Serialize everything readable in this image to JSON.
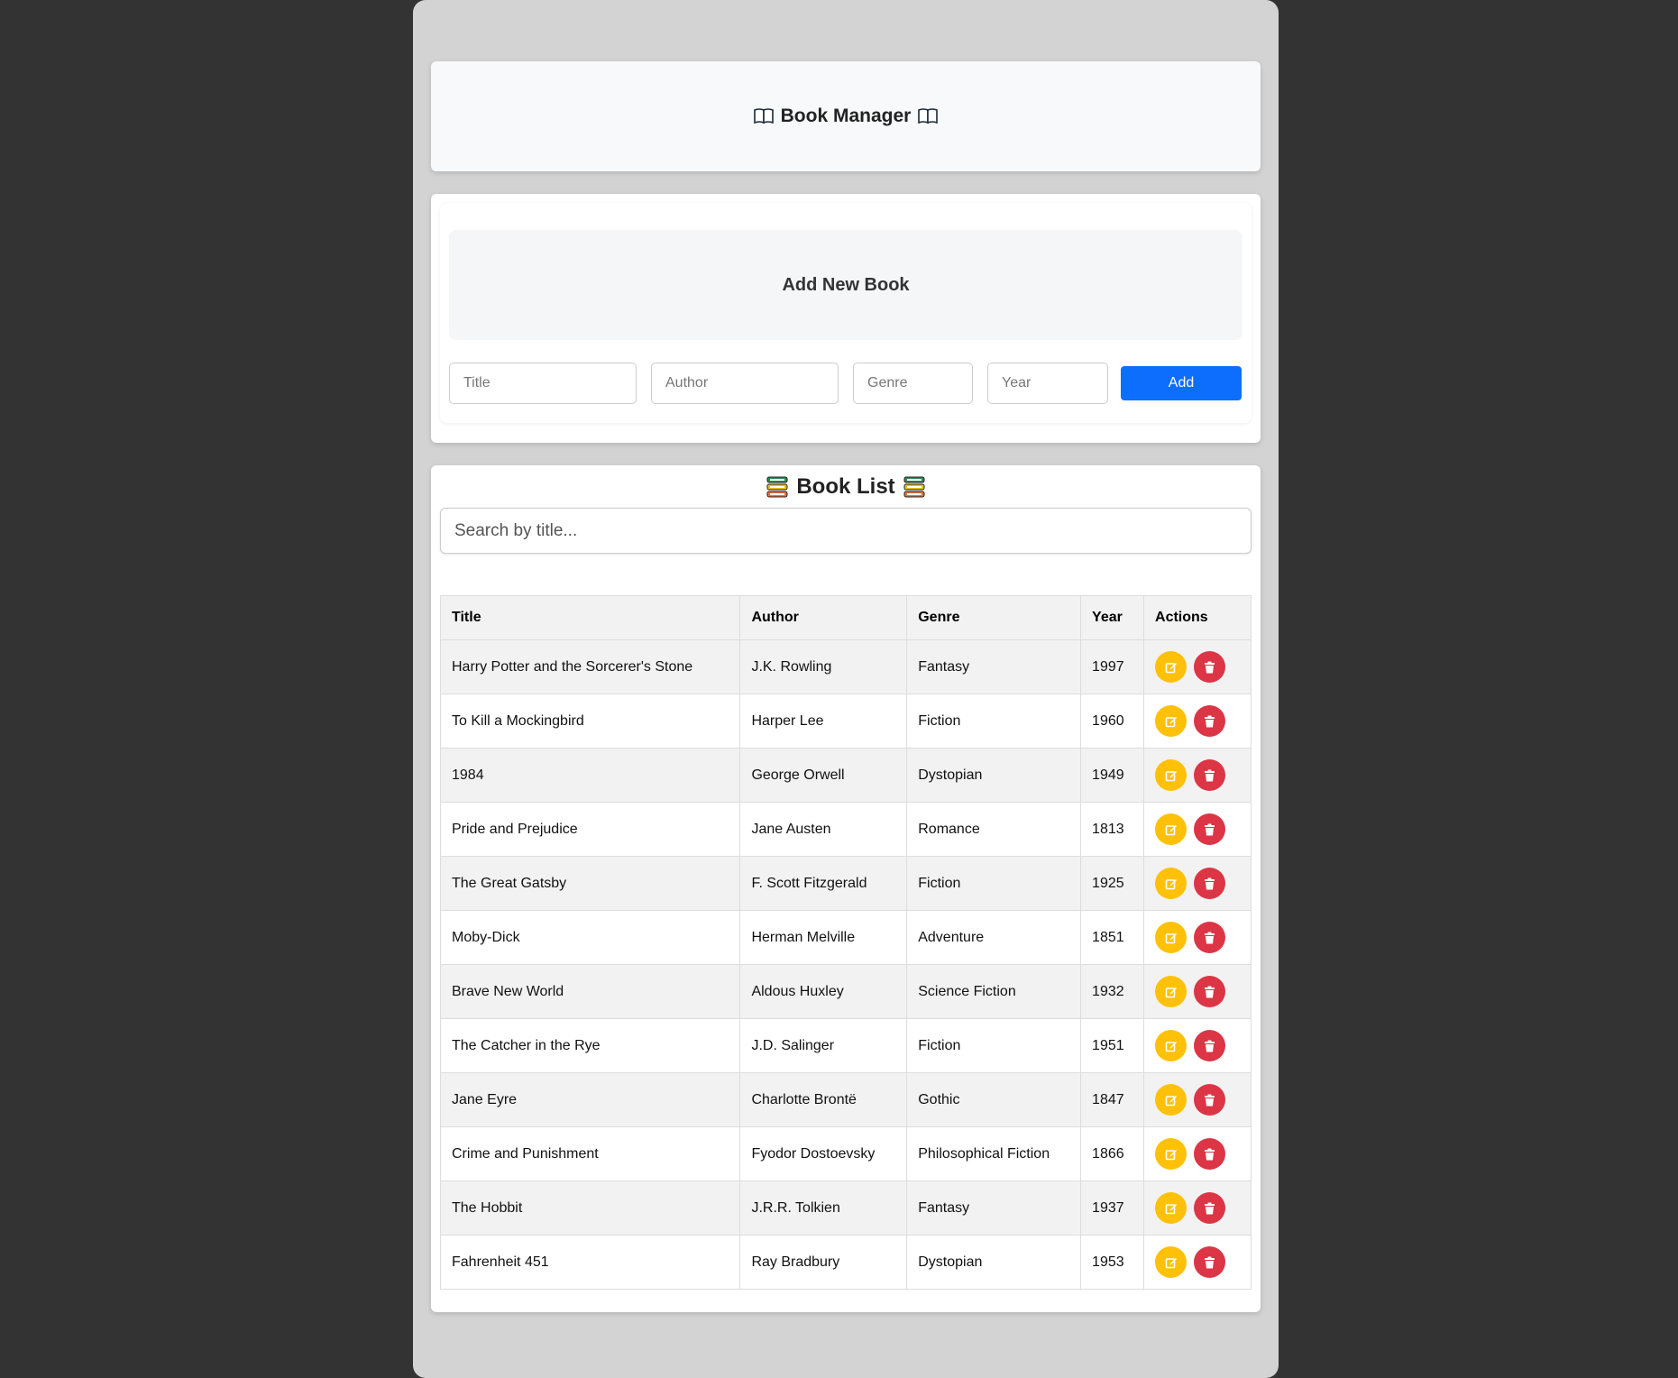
{
  "header": {
    "title": "Book Manager",
    "icon": "open-book-icon"
  },
  "form": {
    "heading": "Add New Book",
    "title_placeholder": "Title",
    "author_placeholder": "Author",
    "genre_placeholder": "Genre",
    "year_placeholder": "Year",
    "add_label": "Add"
  },
  "list": {
    "title": "Book List",
    "icon": "books-stack-icon",
    "search_placeholder": "Search by title...",
    "columns": [
      "Title",
      "Author",
      "Genre",
      "Year",
      "Actions"
    ],
    "rows": [
      [
        "Harry Potter and the Sorcerer's Stone",
        "J.K. Rowling",
        "Fantasy",
        "1997"
      ],
      [
        "To Kill a Mockingbird",
        "Harper Lee",
        "Fiction",
        "1960"
      ],
      [
        "1984",
        "George Orwell",
        "Dystopian",
        "1949"
      ],
      [
        "Pride and Prejudice",
        "Jane Austen",
        "Romance",
        "1813"
      ],
      [
        "The Great Gatsby",
        "F. Scott Fitzgerald",
        "Fiction",
        "1925"
      ],
      [
        "Moby-Dick",
        "Herman Melville",
        "Adventure",
        "1851"
      ],
      [
        "Brave New World",
        "Aldous Huxley",
        "Science Fiction",
        "1932"
      ],
      [
        "The Catcher in the Rye",
        "J.D. Salinger",
        "Fiction",
        "1951"
      ],
      [
        "Jane Eyre",
        "Charlotte Brontë",
        "Gothic",
        "1847"
      ],
      [
        "Crime and Punishment",
        "Fyodor Dostoevsky",
        "Philosophical Fiction",
        "1866"
      ],
      [
        "The Hobbit",
        "J.R.R. Tolkien",
        "Fantasy",
        "1937"
      ],
      [
        "Fahrenheit 451",
        "Ray Bradbury",
        "Dystopian",
        "1953"
      ]
    ]
  },
  "colors": {
    "primary": "#0d6efd",
    "edit": "#ffc107",
    "delete": "#dc3545",
    "background": "#333333",
    "panel": "#d3d3d3"
  }
}
